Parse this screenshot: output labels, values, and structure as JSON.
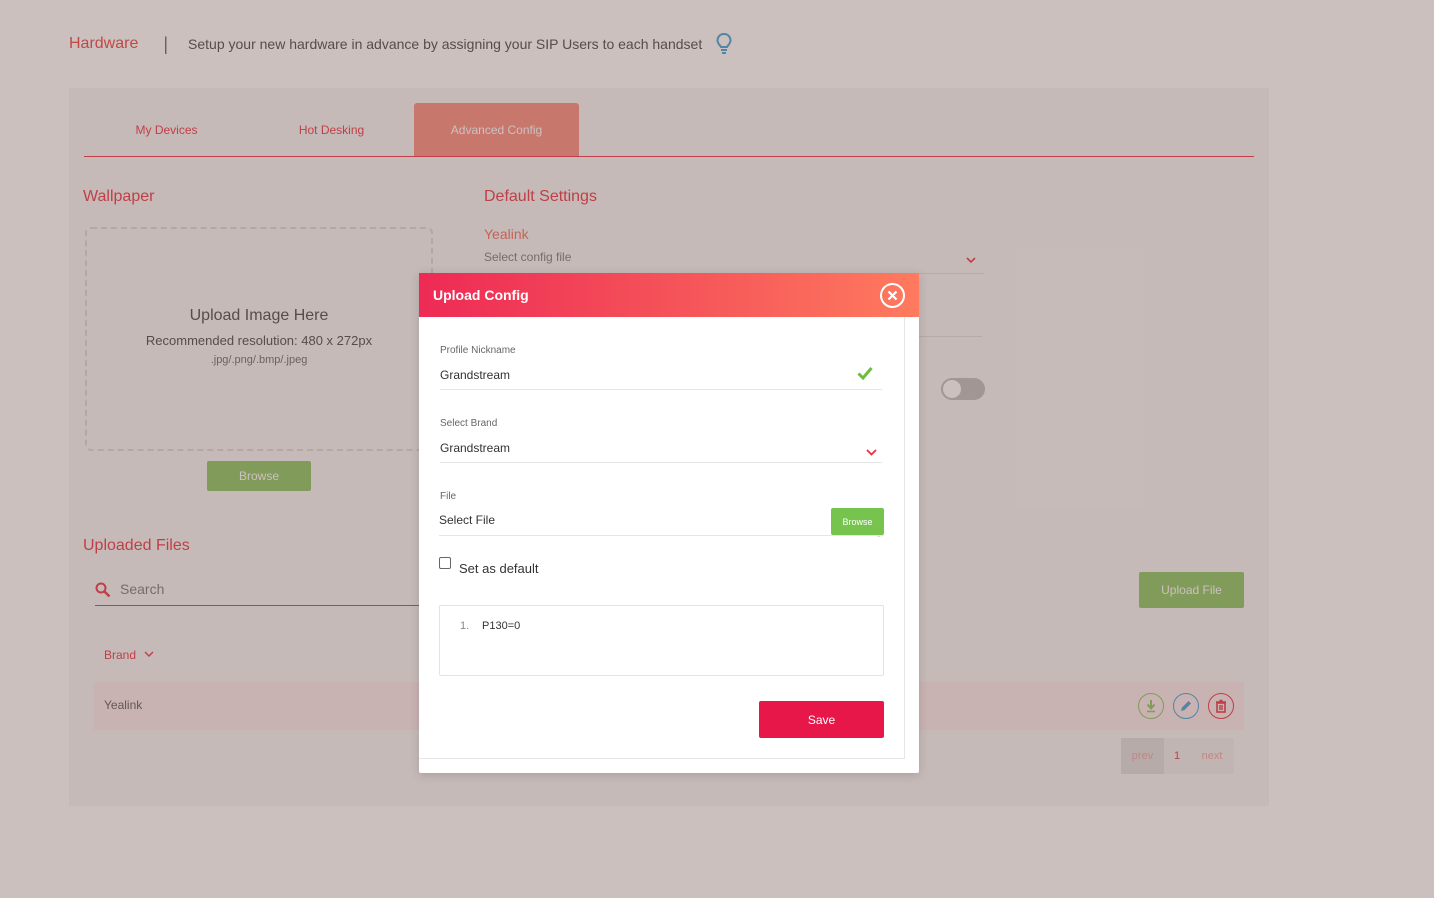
{
  "header": {
    "title": "Hardware",
    "separator": "|",
    "description": "Setup your new hardware in advance by assigning your SIP Users to each handset"
  },
  "tabs": [
    {
      "label": "My Devices"
    },
    {
      "label": "Hot Desking"
    },
    {
      "label": "Advanced Config"
    }
  ],
  "wallpaper": {
    "title": "Wallpaper",
    "upload_text": "Upload Image Here",
    "resolution": "Recommended resolution: 480 x 272px",
    "formats": ".jpg/.png/.bmp/.jpeg",
    "browse_label": "Browse"
  },
  "default_settings": {
    "title": "Default Settings",
    "brand_label": "Yealink",
    "config_placeholder": "Select config file"
  },
  "uploaded_files": {
    "title": "Uploaded Files",
    "search_placeholder": "Search",
    "upload_button": "Upload File",
    "column_brand": "Brand",
    "rows": [
      {
        "brand": "Yealink"
      }
    ]
  },
  "pagination": {
    "prev": "prev",
    "page": "1",
    "next": "next"
  },
  "modal": {
    "title": "Upload Config",
    "nickname_label": "Profile Nickname",
    "nickname_value": "Grandstream",
    "brand_label": "Select Brand",
    "brand_value": "Grandstream",
    "file_label": "File",
    "file_placeholder": "Select File",
    "file_browse": "Browse",
    "required_mark": "*",
    "set_default_label": "Set as default",
    "editor_lines": [
      {
        "num": "1.",
        "text": "P130=0"
      }
    ],
    "save_label": "Save"
  },
  "colors": {
    "accent": "#e8303f",
    "green": "#86c55e",
    "save": "#e8174a"
  }
}
